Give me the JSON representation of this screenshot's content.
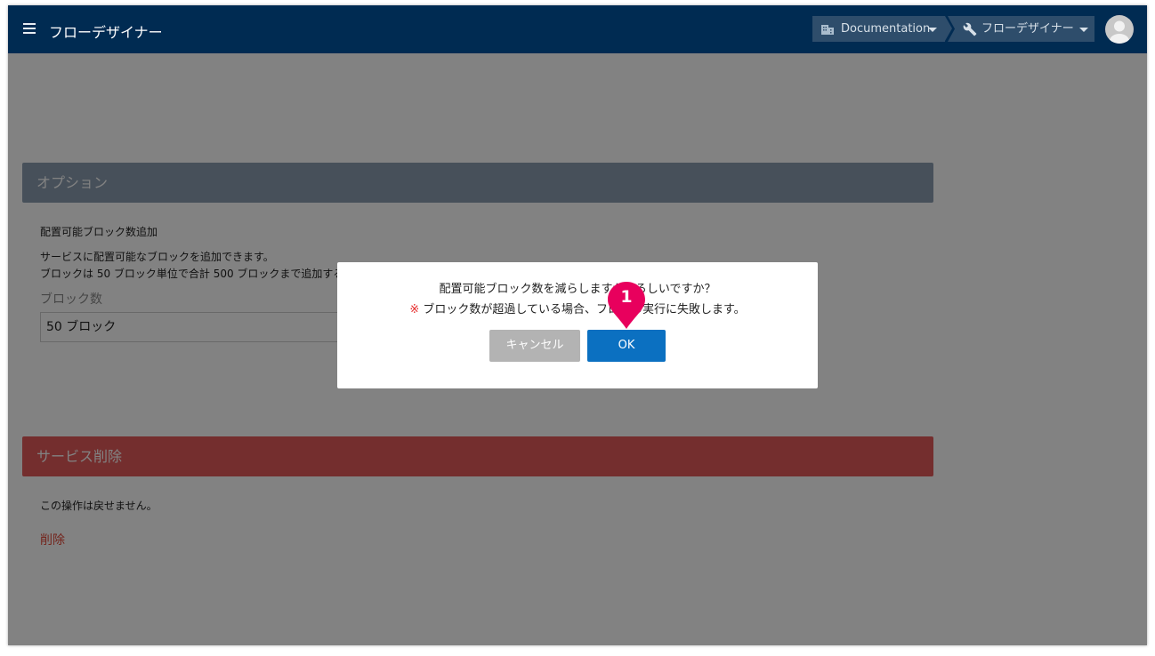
{
  "appbar": {
    "title": "フローデザイナー",
    "breadcrumb": [
      {
        "label": "Documentation",
        "icon": "building-icon"
      },
      {
        "label": "フローデザイナー",
        "icon": "wrench-icon"
      }
    ]
  },
  "options": {
    "header": "オプション",
    "section_title": "配置可能ブロック数追加",
    "description_line1": "サービスに配置可能なブロックを追加できます。",
    "description_line2": "ブロックは 50 ブロック単位で合計 500 ブロックまで追加する",
    "field_label": "ブロック数",
    "field_value": "50 ブロック"
  },
  "service_delete": {
    "header": "サービス削除",
    "note": "この操作は戻せません。",
    "link": "削除"
  },
  "dialog": {
    "message": "配置可能ブロック数を減らしますがよろしいですか？",
    "warning_mark": "※",
    "warning_text": " ブロック数が超過している場合、フローの実行に失敗します。",
    "cancel_label": "キャンセル",
    "ok_label": "OK"
  },
  "annotation": {
    "step": "1",
    "color": "#e8005d"
  },
  "colors": {
    "appbar": "#002b52",
    "options_header": "#8c9eb0",
    "delete_header": "#e35a5a",
    "ok_button": "#0b70c1",
    "cancel_button": "#b3b3b3"
  }
}
